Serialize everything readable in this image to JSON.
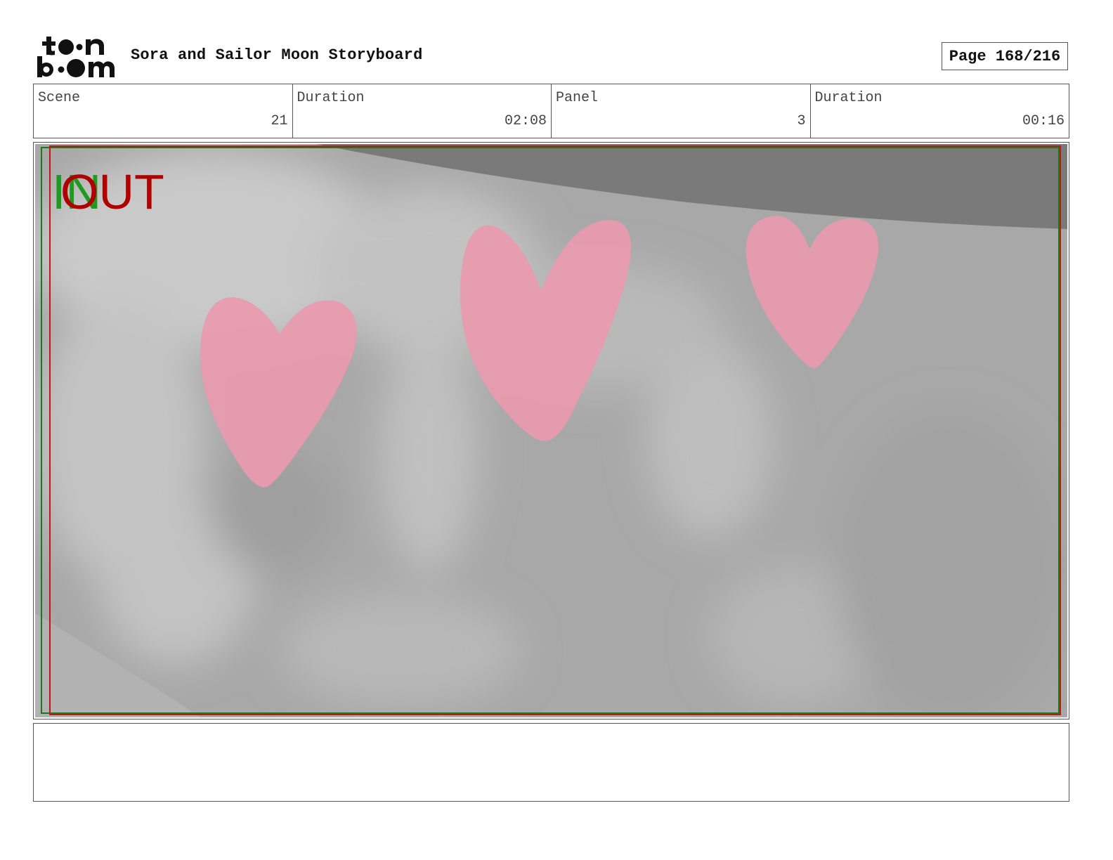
{
  "header": {
    "logo_text": "toon boom",
    "title": "Sora and Sailor Moon Storyboard",
    "page_label": "Page 168/216"
  },
  "info": {
    "scene": {
      "label": "Scene",
      "value": "21"
    },
    "scene_duration": {
      "label": "Duration",
      "value": "02:08"
    },
    "panel": {
      "label": "Panel",
      "value": "3"
    },
    "panel_duration": {
      "label": "Duration",
      "value": "00:16"
    }
  },
  "panel_image": {
    "in_marker": "IN",
    "out_marker": "OUT",
    "colors": {
      "background": "#a9a9a9",
      "heart": "#e89aae",
      "in_marker": "#1e9a1e",
      "out_marker": "#b00000"
    }
  },
  "notes": {
    "text": ""
  }
}
